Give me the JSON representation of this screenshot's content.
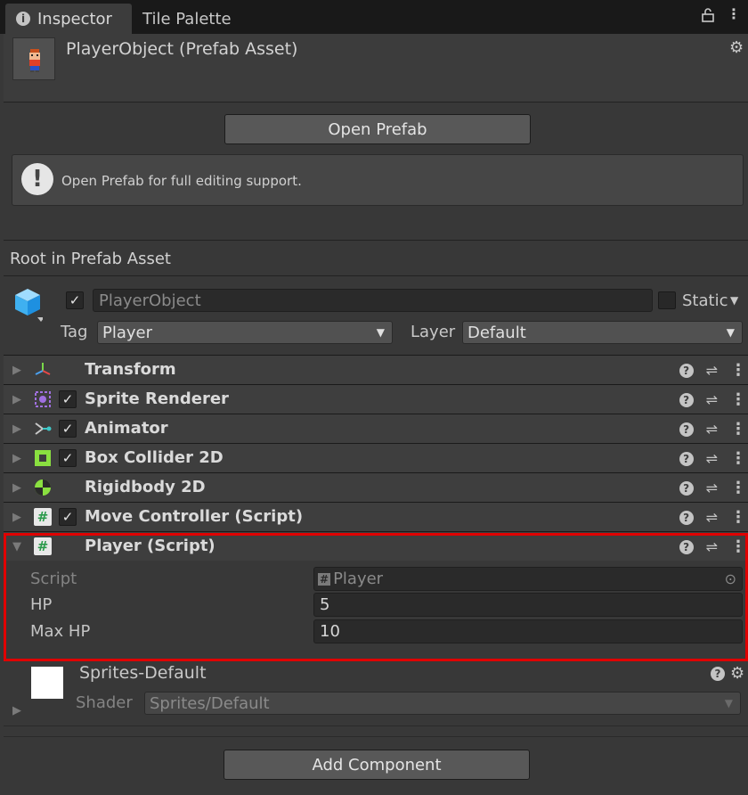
{
  "tabs": [
    {
      "label": "Inspector",
      "active": true
    },
    {
      "label": "Tile Palette",
      "active": false
    }
  ],
  "header": {
    "title": "PlayerObject (Prefab Asset)",
    "open_prefab_label": "Open Prefab",
    "help_text": "Open Prefab for full editing support."
  },
  "root_label": "Root in Prefab Asset",
  "gameobject": {
    "active": true,
    "name": "PlayerObject",
    "static_label": "Static",
    "tag_label": "Tag",
    "tag_value": "Player",
    "layer_label": "Layer",
    "layer_value": "Default"
  },
  "components": [
    {
      "name": "Transform",
      "icon": "transform-icon",
      "has_checkbox": false,
      "checked": false
    },
    {
      "name": "Sprite Renderer",
      "icon": "sprite-renderer-icon",
      "has_checkbox": true,
      "checked": true
    },
    {
      "name": "Animator",
      "icon": "animator-icon",
      "has_checkbox": true,
      "checked": true
    },
    {
      "name": "Box Collider 2D",
      "icon": "box-collider-icon",
      "has_checkbox": true,
      "checked": true
    },
    {
      "name": "Rigidbody 2D",
      "icon": "rigidbody-icon",
      "has_checkbox": false,
      "checked": false
    },
    {
      "name": "Move Controller (Script)",
      "icon": "script-icon",
      "has_checkbox": true,
      "checked": true
    },
    {
      "name": "Player (Script)",
      "icon": "script-icon",
      "has_checkbox": false,
      "checked": false,
      "expanded": true
    }
  ],
  "player_script": {
    "script_label": "Script",
    "script_value": "Player",
    "hp_label": "HP",
    "hp_value": "5",
    "max_hp_label": "Max HP",
    "max_hp_value": "10"
  },
  "material": {
    "name": "Sprites-Default",
    "shader_label": "Shader",
    "shader_value": "Sprites/Default"
  },
  "add_component_label": "Add Component",
  "colors": {
    "highlight": "#e00000",
    "background": "#383838",
    "row": "#3e3e3e"
  }
}
